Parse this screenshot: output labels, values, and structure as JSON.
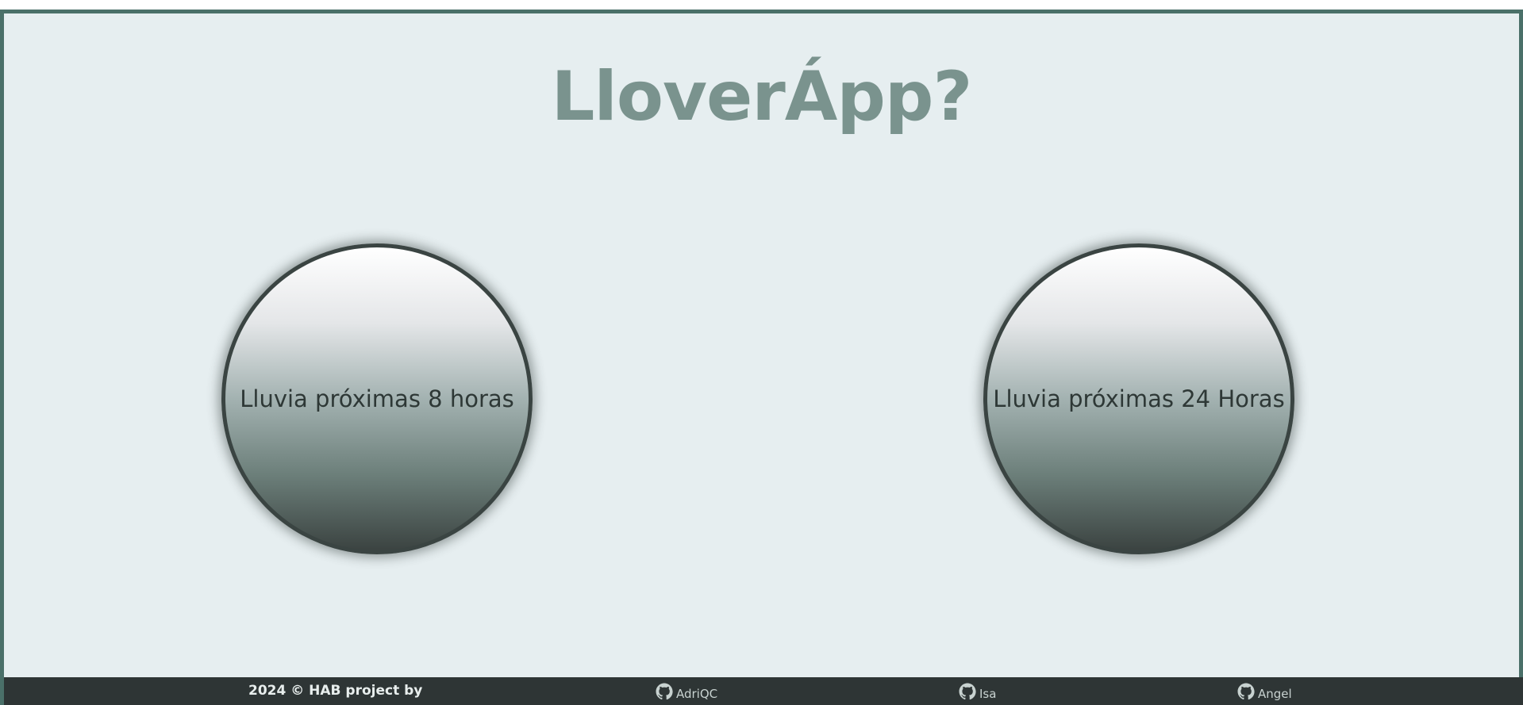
{
  "header": {
    "title": "LloverÁpp?"
  },
  "buttons": [
    {
      "label": "Lluvia próximas 8 horas"
    },
    {
      "label": "Lluvia próximas 24 Horas"
    }
  ],
  "footer": {
    "copyright": "2024 © HAB project by",
    "authors": [
      {
        "name": "AdriQC",
        "icon": "github-icon"
      },
      {
        "name": "Isa",
        "icon": "github-icon"
      },
      {
        "name": "Angel",
        "icon": "github-icon"
      }
    ]
  },
  "colors": {
    "frame_border": "#4a7069",
    "background": "#e6eef0",
    "title": "#7a938e",
    "footer_bg": "#2e3535"
  }
}
